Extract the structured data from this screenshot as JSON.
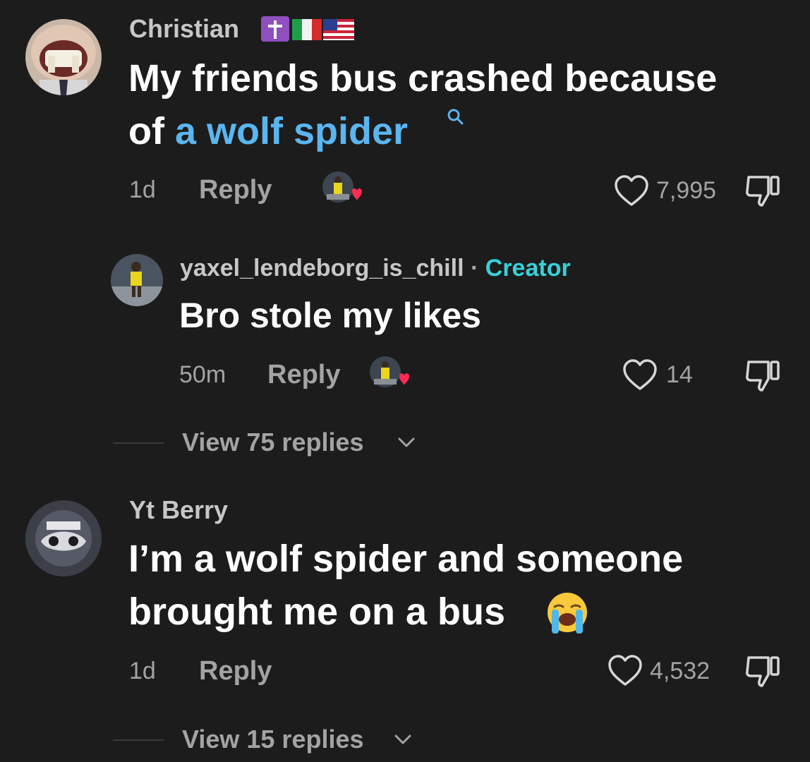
{
  "comments": [
    {
      "username": "Christian",
      "badges": [
        "latin-cross",
        "italy-flag",
        "usa-flag"
      ],
      "text_line1": "My friends bus crashed because",
      "text_line2_prefix": "of ",
      "text_line2_link": "a wolf spider",
      "timestamp": "1d",
      "reply_label": "Reply",
      "likes": "7,995"
    },
    {
      "username": "yaxel_lendeborg_is_chill",
      "separator": "·",
      "role_label": "Creator",
      "text": "Bro stole my likes",
      "timestamp": "50m",
      "reply_label": "Reply",
      "likes": "14"
    },
    {
      "username": "Yt Berry",
      "text_line1": "I’m a wolf spider and someone",
      "text_line2": "brought me on a bus",
      "emoji": "loudly-crying-face",
      "timestamp": "1d",
      "reply_label": "Reply",
      "likes": "4,532"
    }
  ],
  "view_replies": [
    {
      "label": "View 75 replies"
    },
    {
      "label": "View 15 replies"
    }
  ],
  "colors": {
    "background": "#1c1c1c",
    "link": "#5bb5f0",
    "creator": "#37d1da",
    "muted": "#a3a3a3",
    "liked_heart": "#fe2c55"
  }
}
